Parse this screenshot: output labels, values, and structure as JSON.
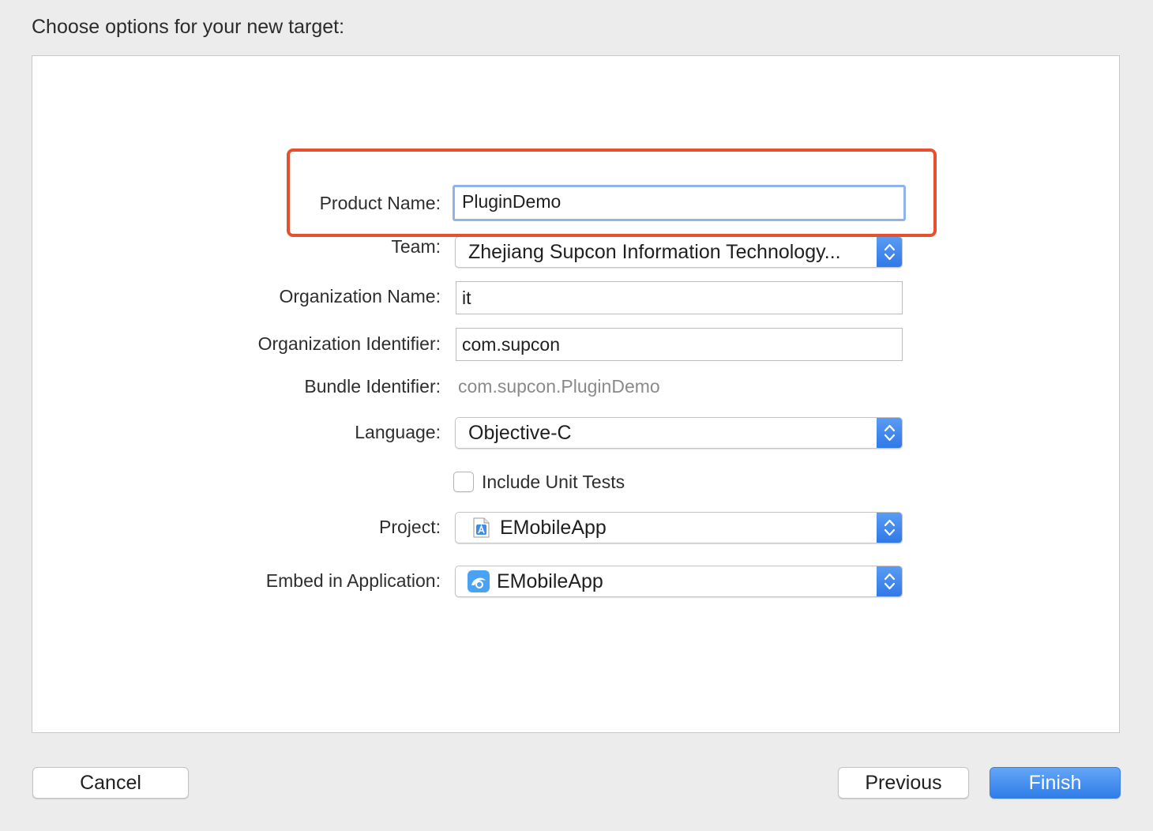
{
  "dialog": {
    "heading": "Choose options for your new target:"
  },
  "form": {
    "product_name": {
      "label": "Product Name:",
      "value": "PluginDemo"
    },
    "team": {
      "label": "Team:",
      "value": "Zhejiang Supcon Information Technology..."
    },
    "organization_name": {
      "label": "Organization Name:",
      "value": "it"
    },
    "organization_identifier": {
      "label": "Organization Identifier:",
      "value": "com.supcon"
    },
    "bundle_identifier": {
      "label": "Bundle Identifier:",
      "value": "com.supcon.PluginDemo"
    },
    "language": {
      "label": "Language:",
      "value": "Objective-C"
    },
    "include_unit_tests": {
      "label": "Include Unit Tests",
      "checked": false
    },
    "project": {
      "label": "Project:",
      "value": "EMobileApp",
      "icon": "xcode-project-icon"
    },
    "embed_in_application": {
      "label": "Embed in Application:",
      "value": "EMobileApp",
      "icon": "app-icon"
    }
  },
  "buttons": {
    "cancel": "Cancel",
    "previous": "Previous",
    "finish": "Finish"
  },
  "colors": {
    "accent": "#3b82f0",
    "highlight_annotation": "#e6502e",
    "focus_ring": "#8fb3ea"
  }
}
